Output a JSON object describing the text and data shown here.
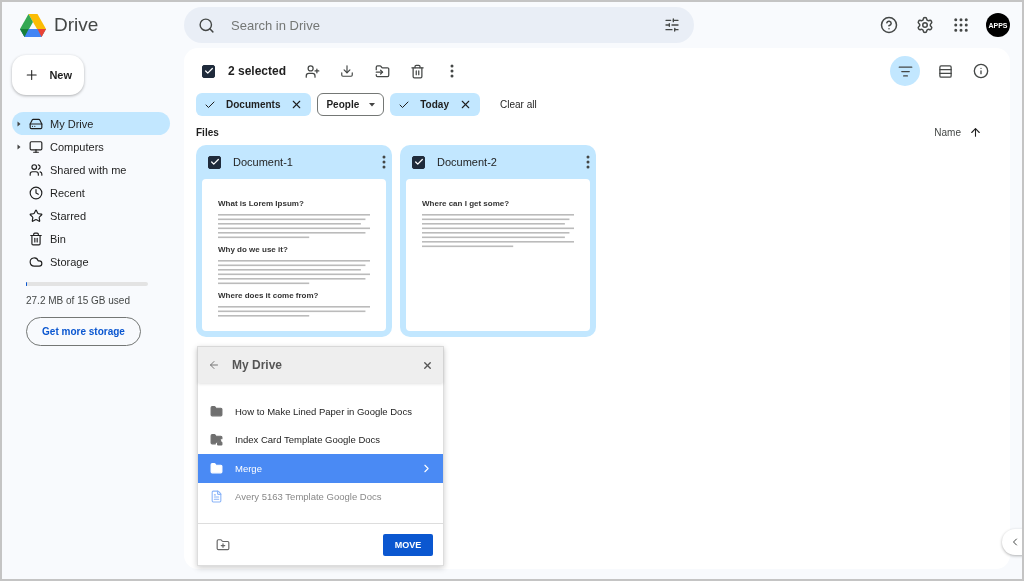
{
  "app": {
    "name": "Drive"
  },
  "search": {
    "placeholder": "Search in Drive"
  },
  "avatar": {
    "label": "APPS"
  },
  "new_button": {
    "label": "New"
  },
  "sidebar": {
    "items": [
      {
        "label": "My Drive",
        "selected": true,
        "expandable": true
      },
      {
        "label": "Computers",
        "selected": false,
        "expandable": true
      },
      {
        "label": "Shared with me",
        "selected": false,
        "expandable": false
      },
      {
        "label": "Recent",
        "selected": false,
        "expandable": false
      },
      {
        "label": "Starred",
        "selected": false,
        "expandable": false
      },
      {
        "label": "Bin",
        "selected": false,
        "expandable": false
      },
      {
        "label": "Storage",
        "selected": false,
        "expandable": false
      }
    ]
  },
  "storage": {
    "level": 0.002,
    "text": "27.2 MB of 15 GB used",
    "button": "Get more storage"
  },
  "selection_bar": {
    "checked": true,
    "count": "2 selected"
  },
  "view": {
    "filter_selected": true
  },
  "chips": [
    {
      "label": "Documents",
      "active": true
    },
    {
      "label": "People",
      "active": false
    },
    {
      "label": "Today",
      "active": true
    }
  ],
  "clear_all": "Clear all",
  "section": {
    "title": "Files",
    "sort": "Name"
  },
  "files": [
    {
      "name": "Document-1",
      "checked": true,
      "preview": [
        "What is Lorem Ipsum?",
        "Why do we use it?",
        "Where does it come from?"
      ]
    },
    {
      "name": "Document-2",
      "checked": true,
      "preview": [
        "Where can I get some?"
      ]
    }
  ],
  "move_dialog": {
    "title": "My Drive",
    "items": [
      {
        "kind": "folder",
        "label": "How to Make Lined Paper in Google Docs",
        "selected": false,
        "disabled": false
      },
      {
        "kind": "shared-folder",
        "label": "Index Card Template Google Docs",
        "selected": false,
        "disabled": false
      },
      {
        "kind": "folder",
        "label": "Merge",
        "selected": true,
        "disabled": false
      },
      {
        "kind": "doc",
        "label": "Avery 5163 Template Google Docs",
        "selected": false,
        "disabled": true
      }
    ],
    "button": "MOVE"
  }
}
